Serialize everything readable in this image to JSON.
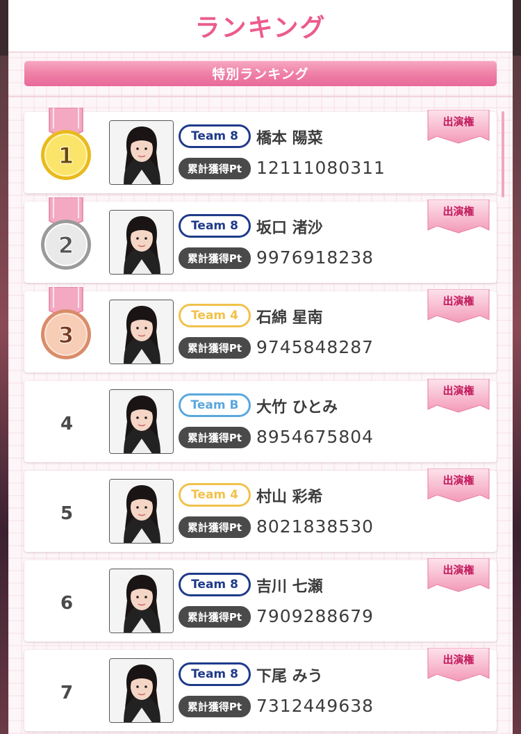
{
  "header": {
    "title": "ランキング"
  },
  "subbar": {
    "title": "特別ランキング"
  },
  "colors": {
    "accent": "#ec5b8c",
    "team8": "#1f3a8a",
    "team4": "#f2c14a",
    "teamB": "#5aa7dc"
  },
  "pt_label": "累計獲得Pt",
  "ribbon_label": "出演権",
  "rows": [
    {
      "rank": "1",
      "team": "Team 8",
      "team_color": "#1f3a8a",
      "name": "橋本 陽菜",
      "points": "12111080311",
      "medal": "gold"
    },
    {
      "rank": "2",
      "team": "Team 8",
      "team_color": "#1f3a8a",
      "name": "坂口 渚沙",
      "points": "9976918238",
      "medal": "silver"
    },
    {
      "rank": "3",
      "team": "Team 4",
      "team_color": "#f2c14a",
      "name": "石綿 星南",
      "points": "9745848287",
      "medal": "bronze"
    },
    {
      "rank": "4",
      "team": "Team B",
      "team_color": "#5aa7dc",
      "name": "大竹 ひとみ",
      "points": "8954675804",
      "medal": ""
    },
    {
      "rank": "5",
      "team": "Team 4",
      "team_color": "#f2c14a",
      "name": "村山 彩希",
      "points": "8021838530",
      "medal": ""
    },
    {
      "rank": "6",
      "team": "Team 8",
      "team_color": "#1f3a8a",
      "name": "吉川 七瀬",
      "points": "7909288679",
      "medal": ""
    },
    {
      "rank": "7",
      "team": "Team 8",
      "team_color": "#1f3a8a",
      "name": "下尾 みう",
      "points": "7312449638",
      "medal": ""
    }
  ]
}
